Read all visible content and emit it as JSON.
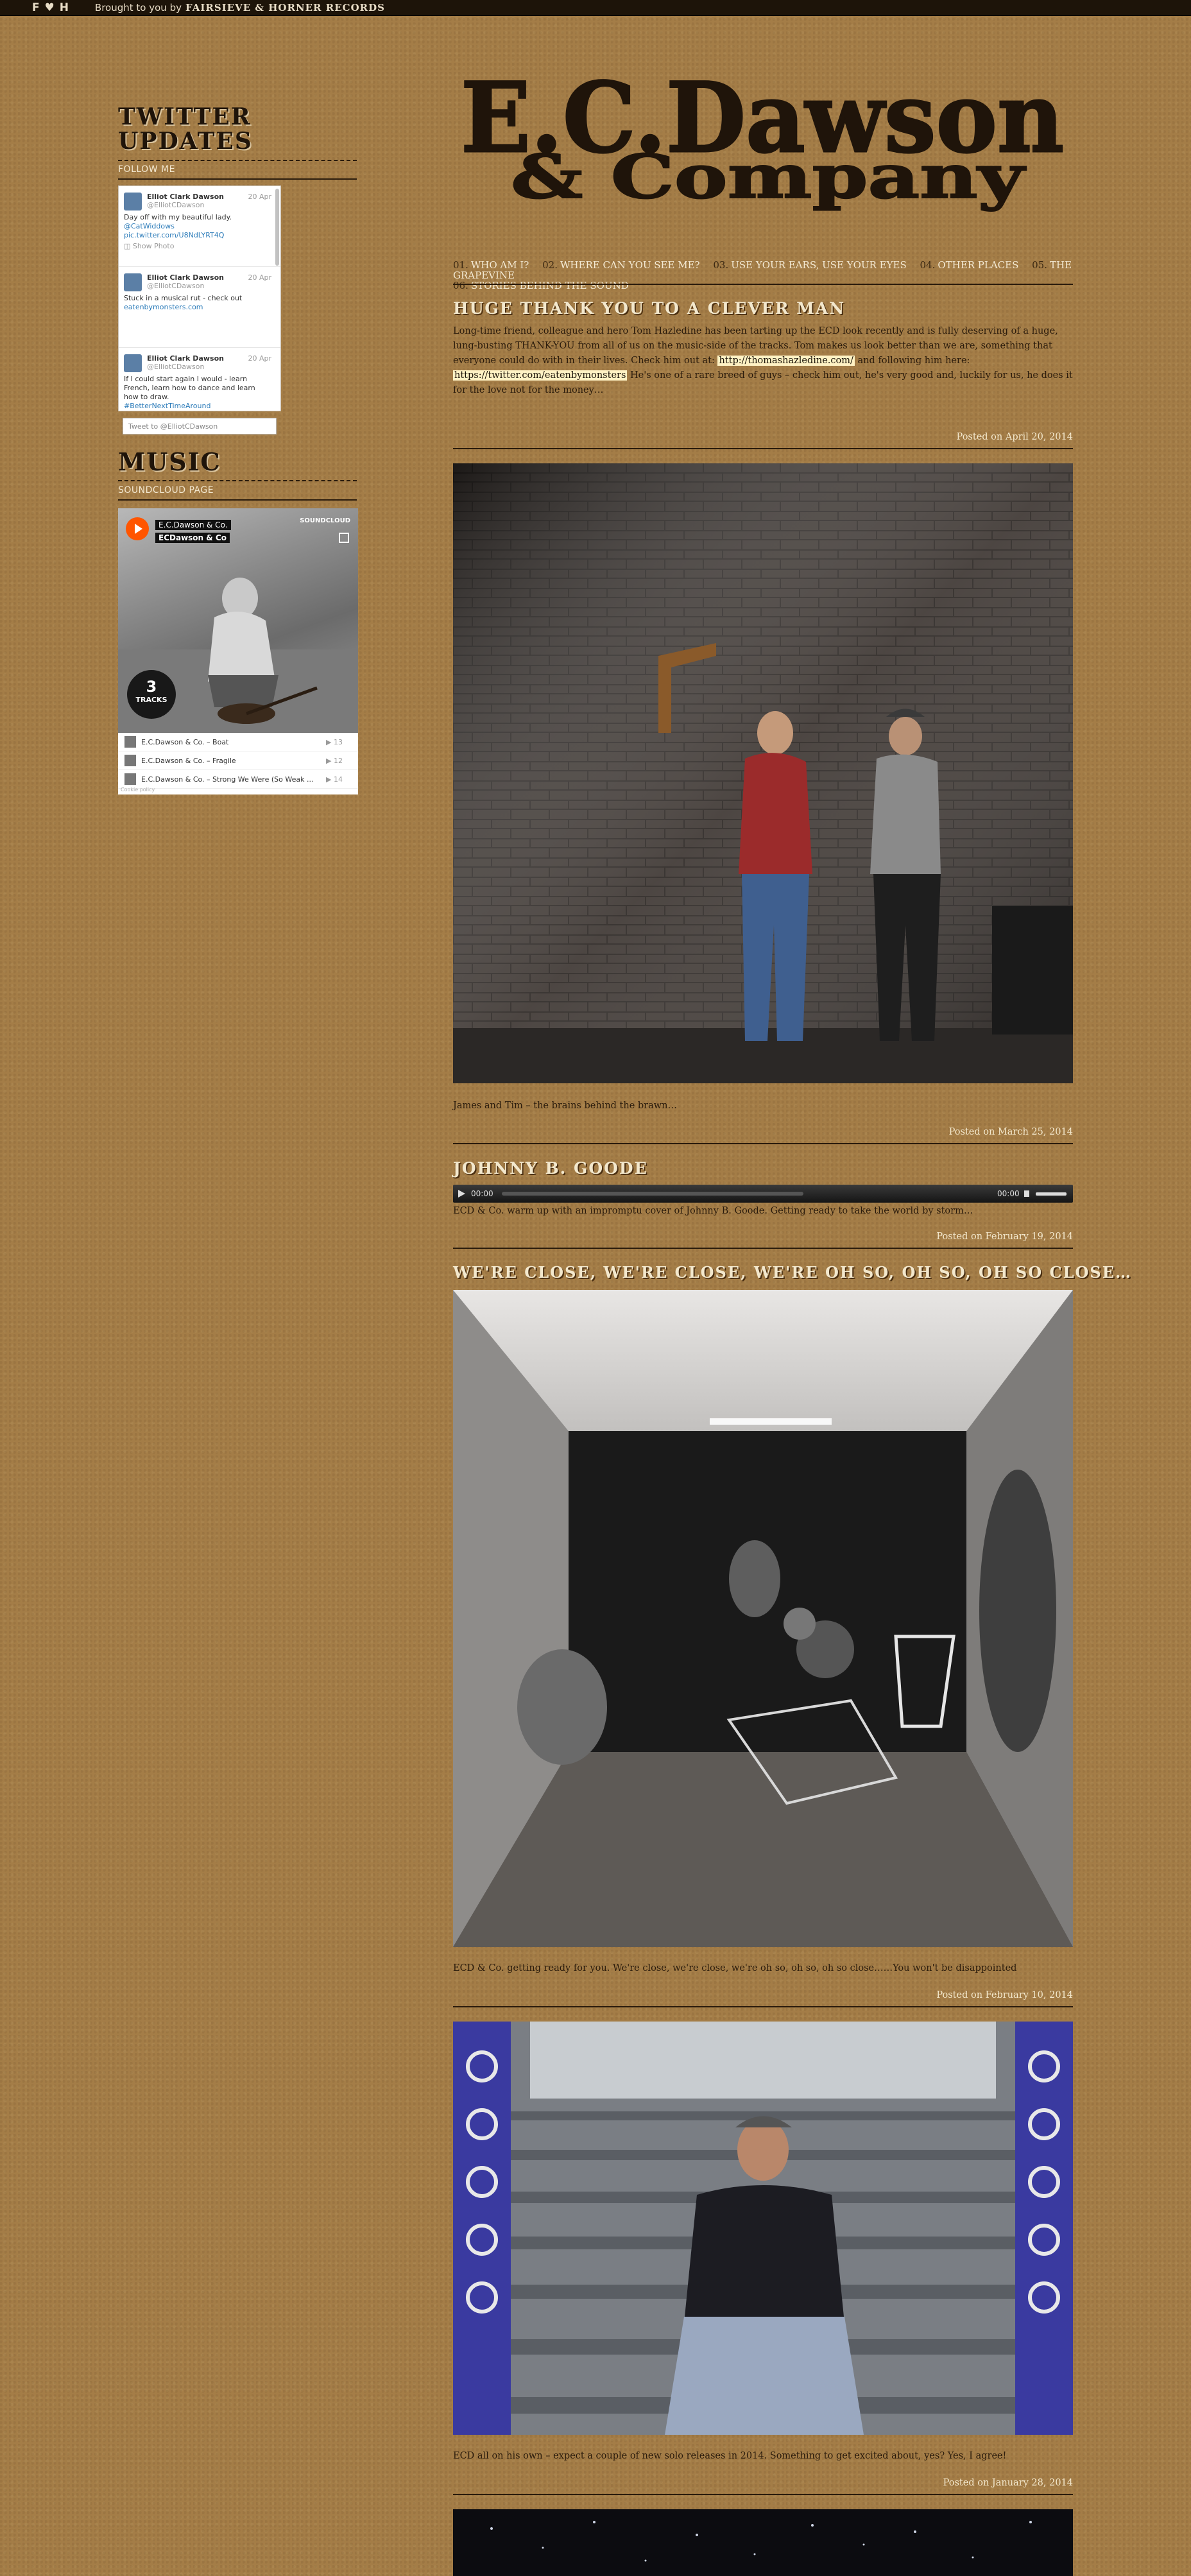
{
  "topbar": {
    "logo_text": "F ♥ H",
    "brought_by": "Brought to you by",
    "brand": "Fairsieve & Horner Records"
  },
  "sidebar": {
    "twitter": {
      "title_line1": "Twitter",
      "title_line2": "Updates",
      "follow_label": "Follow Me",
      "tweets": [
        {
          "name": "Elliot Clark Dawson",
          "handle": "@ElliotCDawson",
          "date": "20 Apr",
          "text": "Day off with my beautiful lady.",
          "link": "@CatWiddows",
          "link2": "pic.twitter.com/U8NdLYRT4Q",
          "show": "Show Photo"
        },
        {
          "name": "Elliot Clark Dawson",
          "handle": "@ElliotCDawson",
          "date": "20 Apr",
          "text": "Stuck in a musical rut - check out",
          "link": "eatenbymonsters.com"
        },
        {
          "name": "Elliot Clark Dawson",
          "handle": "@ElliotCDawson",
          "date": "20 Apr",
          "text": "If I could start again I would - learn French, learn how to dance and learn how to draw.",
          "link": "#BetterNextTimeAround"
        }
      ],
      "tweet_to_placeholder": "Tweet to @ElliotCDawson"
    },
    "music": {
      "title": "Music",
      "sub": "Soundcloud Page",
      "artist": "E.C.Dawson & Co.",
      "set_name": "ECDawson & Co",
      "tracks_count": "3",
      "tracks_label": "TRACKS",
      "brand": "SOUNDCLOUD",
      "tracks": [
        {
          "title": "E.C.Dawson & Co. – Boat",
          "plays": "13"
        },
        {
          "title": "E.C.Dawson & Co. – Fragile",
          "plays": "12"
        },
        {
          "title": "E.C.Dawson & Co. – Strong We Were (So Weak ...",
          "plays": "14"
        }
      ],
      "cookie_policy": "Cookie policy"
    }
  },
  "header": {
    "logo_line1": "E.C.Dawson",
    "logo_line2": "& Company"
  },
  "nav": [
    {
      "num": "01.",
      "label": "Who am I?"
    },
    {
      "num": "02.",
      "label": "Where can you see me?"
    },
    {
      "num": "03.",
      "label": "Use your ears, use your eyes"
    },
    {
      "num": "04.",
      "label": "Other places"
    },
    {
      "num": "05.",
      "label": "The Grapevine"
    },
    {
      "num": "06.",
      "label": "Stories behind the sound"
    }
  ],
  "posts": [
    {
      "title": "Huge Thank You to a Clever Man",
      "body_pre": "Long-time friend, colleague and hero Tom Hazledine has been tarting up the ECD look recently and is fully deserving of a huge, lung-busting THANK-YOU from all of us on the music-side of the tracks. Tom makes us look better than we are, something that everyone could do with in their lives. Check him out at: ",
      "link1": "http://thomashazledine.com/",
      "body_mid": " and following him here: ",
      "link2": "https://twitter.com/eatenbymonsters",
      "body_post": " He's one of a rare breed of guys – check him out, he's very good and, luckily for us, he does it for the love not for the money…",
      "posted": "Posted on April 20, 2014"
    },
    {
      "caption": "James and Tim – the brains behind the brawn…",
      "posted": "Posted on March 25, 2014"
    },
    {
      "title": "Johnny B. Goode",
      "audio_start": "00:00",
      "audio_end": "00:00",
      "body": "ECD & Co. warm up with an impromptu cover of Johnny B. Goode. Getting ready to take the world by storm…",
      "posted": "Posted on February 19, 2014"
    },
    {
      "title": "We're close, we're close, we're oh so, oh so, oh so close…",
      "caption": "ECD & Co. getting ready for you. We're close, we're close, we're oh so, oh so, oh so close……You won't be disappointed",
      "posted": "Posted on February 10, 2014"
    },
    {
      "caption": "ECD all on his own – expect a couple of new solo releases in 2014. Something to get excited about, yes? Yes, I agree!",
      "posted": "Posted on January 28, 2014"
    }
  ],
  "colors": {
    "background": "#a47d47",
    "topbar": "#1d1409",
    "cream": "#f3e8cd",
    "dark_brown": "#2a1b0c",
    "soundcloud": "#ff5500"
  }
}
